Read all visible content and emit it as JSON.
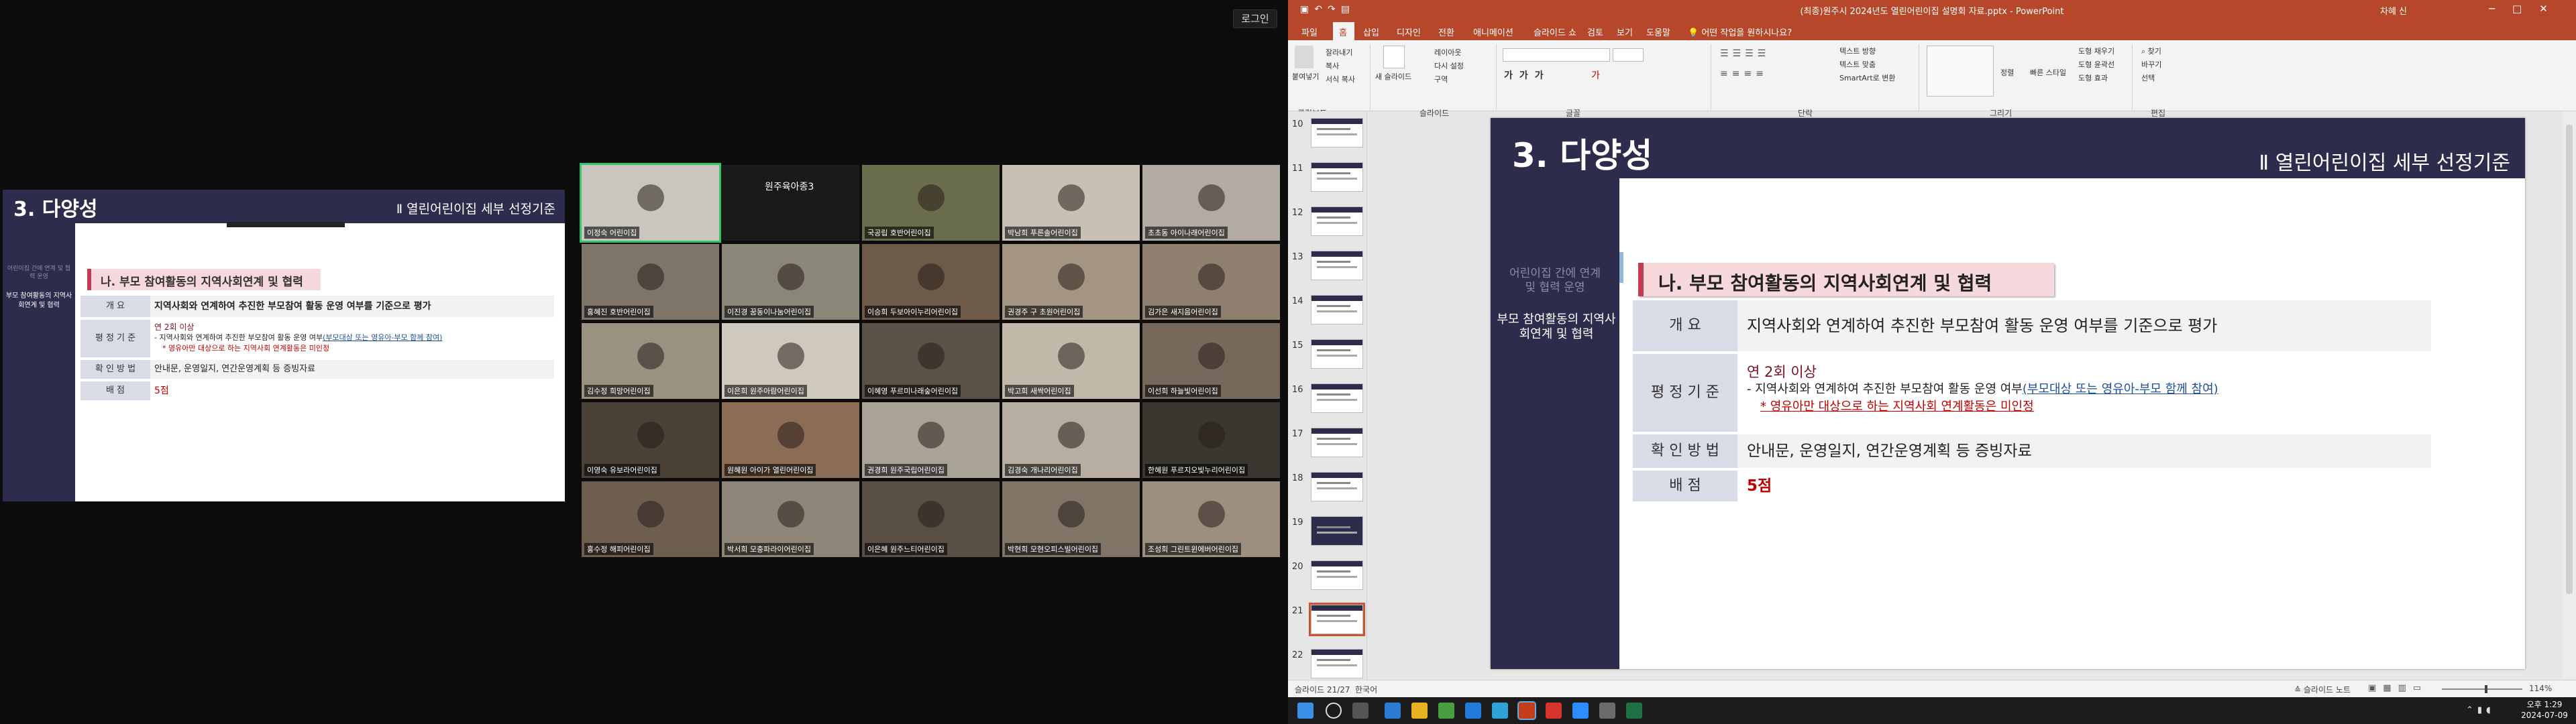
{
  "left_monitor": {
    "login_button": "로그인",
    "shared_slide": {
      "title": "3. 다양성",
      "right_title": "Ⅱ 열린어린이집 세부 선정기준",
      "side_item_dim": "어린이집 간에 연계 및 협력 운영",
      "side_item_active": "부모 참여활동의 지역사회연계 및 협력",
      "badge": "나. 부모 참여활동의 지역사회연계 및 협력",
      "rows": {
        "overview_label": "개 요",
        "overview_value": "지역사회와 연계하여 추진한 부모참여 활동 운영 여부를 기준으로 평가",
        "criteria_label": "평 정 기 준",
        "criteria_line1": "연 2회 이상",
        "criteria_line2_a": "- 지역사회와 연계하여 추진한 부모참여 활동 운영 여부",
        "criteria_line2_b": "(부모대상 또는 영유아-부모 함께 참여)",
        "criteria_line3": "* 영유아만 대상으로 하는 지역사회 연계활동은 미인정",
        "method_label": "확 인 방 법",
        "method_value": "안내문, 운영일지, 연간운영계획 등 증빙자료",
        "score_label": "배 점",
        "score_value": "5점"
      }
    },
    "participants": [
      "이정숙 어린이집",
      "원주육아종3",
      "국공립 호반어린이집",
      "박남희 푸른솔어린이집",
      "초초동 아이나래어린이집",
      "홍혜진 호반어린이집",
      "이진경 꿈동이나눔어린이집",
      "이승희 두보아이누리어린이집",
      "권경주 구 초원어린이집",
      "김가은 새지음어린이집",
      "김수정 희망어린이집",
      "이은희 원주아람어린이집",
      "이혜영 푸르미나래숲어린이집",
      "박고희 새싹어린이집",
      "이선희 하늘빛어린이집",
      "이영숙 유보라어린이집",
      "원혜원 아이가 열린어린이집",
      "권경희 원주국립어린이집",
      "김경숙 개나리어린이집",
      "한혜원 푸르지오빛누리어린이집",
      "홍수정 해피어린이집",
      "박서희 모충파라이어린이집",
      "이은혜 원주느티어린이집",
      "박현희 모현오피스빌어린이집",
      "조성희 그린트윈에버어린이집"
    ]
  },
  "powerpoint": {
    "doc_title": "(최종)원주시 2024년도 열린어린이집 설명회 자료.pptx - PowerPoint",
    "user": "차혜 신",
    "tabs": [
      "파일",
      "홈",
      "삽입",
      "디자인",
      "전환",
      "애니메이션",
      "슬라이드 쇼",
      "검토",
      "보기",
      "도움말"
    ],
    "tell_me": "어떤 작업을 원하시나요?",
    "ribbon_groups": [
      "클립보드",
      "슬라이드",
      "글꼴",
      "단락",
      "그리기",
      "편집"
    ],
    "ribbon_items": {
      "paste": "붙여넣기",
      "cut": "잘라내기",
      "copy": "복사",
      "format_painter": "서식 복사",
      "new_slide": "새 슬라이드",
      "layout": "레이아웃",
      "reset": "다시 설정",
      "section": "구역",
      "text_direction": "텍스트 방향",
      "align_text": "텍스트 맞춤",
      "smartart": "SmartArt로 변환",
      "arrange": "정렬",
      "quick_styles": "빠른 스타일",
      "shape_fill": "도형 채우기",
      "shape_outline": "도형 윤곽선",
      "shape_effects": "도형 효과",
      "find": "찾기",
      "replace": "바꾸기",
      "select": "선택"
    },
    "thumbnail_numbers": [
      "10",
      "11",
      "12",
      "13",
      "14",
      "15",
      "16",
      "17",
      "18",
      "19",
      "20",
      "21",
      "22"
    ],
    "selected_slide": "21",
    "slide": {
      "title": "3. 다양성",
      "right_title": "Ⅱ 열린어린이집 세부 선정기준",
      "side_item_dim": "어린이집 간에 연계 및 협력 운영",
      "side_item_active": "부모 참여활동의 지역사회연계 및 협력",
      "badge": "나. 부모 참여활동의 지역사회연계 및 협력",
      "rows": {
        "overview_label": "개 요",
        "overview_value": "지역사회와 연계하여 추진한 부모참여 활동 운영 여부를 기준으로 평가",
        "criteria_label": "평 정 기 준",
        "criteria_line1": "연 2회 이상",
        "criteria_line2_a": "- 지역사회와 연계하여 추진한 부모참여 활동 운영 여부",
        "criteria_line2_b": "(부모대상 또는 영유아-부모 함께 참여)",
        "criteria_line3": "* 영유아만 대상으로 하는 지역사회 연계활동은 미인정",
        "method_label": "확 인 방 법",
        "method_value": "안내문, 운영일지, 연간운영계획 등 증빙자료",
        "score_label": "배 점",
        "score_value": "5점"
      }
    },
    "status": {
      "slide_counter": "슬라이드 21/27",
      "language": "한국어",
      "notes": "슬라이드 노트",
      "zoom": "114%"
    },
    "clock": {
      "time": "오후 1:29",
      "date": "2024-07-09"
    }
  }
}
